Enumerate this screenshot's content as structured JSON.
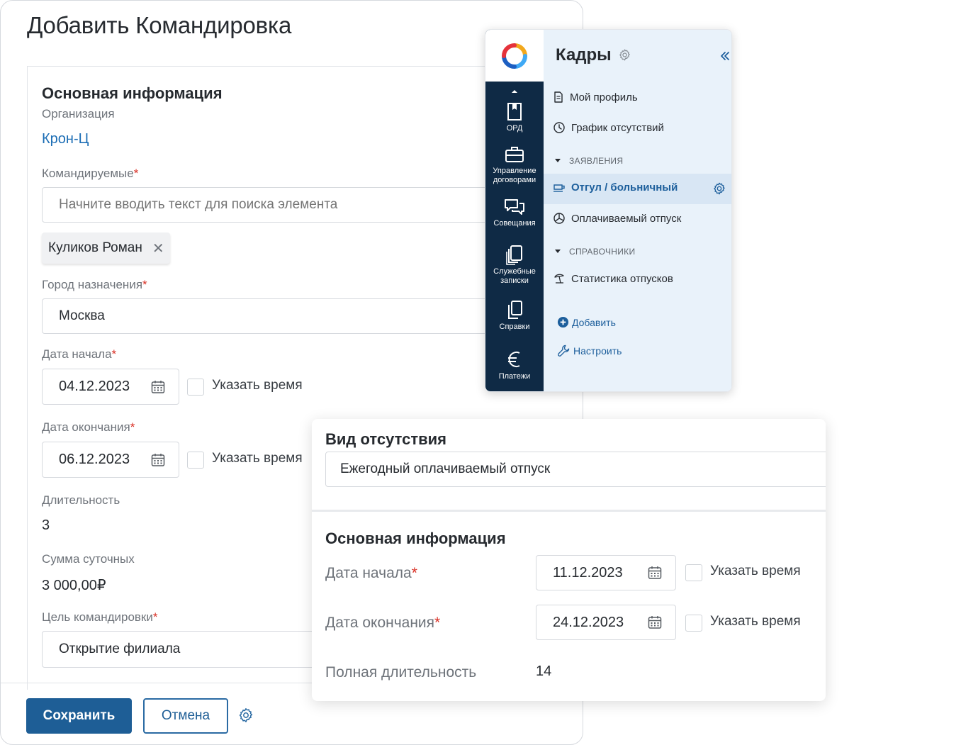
{
  "form": {
    "title": "Добавить Командировка",
    "section_title": "Основная информация",
    "organization_label": "Организация",
    "organization_value": "Крон-Ц",
    "travelers_label": "Командируемые",
    "travelers_placeholder": "Начните вводить текст для поиска элемента",
    "traveler_chip": "Куликов Роман",
    "city_label": "Город назначения",
    "city_value": "Москва",
    "start_label": "Дата начала",
    "start_value": "04.12.2023",
    "end_label": "Дата окончания",
    "end_value": "06.12.2023",
    "specify_time": "Указать время",
    "duration_label": "Длительность",
    "duration_value": "3",
    "per_diem_label": "Сумма суточных",
    "per_diem_value": "3 000,00₽",
    "purpose_label": "Цель командировки",
    "purpose_value": "Открытие филиала",
    "required_mark": "*",
    "save_label": "Сохранить",
    "cancel_label": "Отмена"
  },
  "nav": {
    "app_title": "Кадры",
    "rail": [
      {
        "label": "ОРД",
        "icon": "bookmark-doc-icon"
      },
      {
        "label": "Управление договорами",
        "icon": "briefcase-icon"
      },
      {
        "label": "Совещания",
        "icon": "chat-bubbles-icon"
      },
      {
        "label": "Служебные записки",
        "icon": "stacked-docs-icon"
      },
      {
        "label": "Справки",
        "icon": "copy-docs-icon"
      },
      {
        "label": "Платежи",
        "icon": "euro-icon"
      }
    ],
    "rail_line_1": "Управление",
    "rail_line_2": "договорами",
    "rail_memo_1": "Служебные",
    "rail_memo_2": "записки",
    "items": {
      "profile": "Мой профиль",
      "schedule": "График отсутствий",
      "group_requests": "ЗАЯВЛЕНИЯ",
      "sick": "Отгул / больничный",
      "paid_leave": "Оплачиваемый отпуск",
      "group_refs": "СПРАВОЧНИКИ",
      "stats": "Статистика отпусков",
      "add": "Добавить",
      "configure": "Настроить"
    }
  },
  "absence": {
    "type_label": "Вид отсутствия",
    "type_value": "Ежегодный оплачиваемый отпуск",
    "section_title": "Основная информация",
    "start_label": "Дата начала",
    "start_value": "11.12.2023",
    "end_label": "Дата окончания",
    "end_value": "24.12.2023",
    "specify_time": "Указать время",
    "full_duration_label": "Полная длительность",
    "full_duration_value": "14",
    "required_mark": "*"
  },
  "colors": {
    "primary": "#1e5e96",
    "link": "#1d6eb5",
    "rail": "#0f2a45",
    "panel": "#e9f2fa",
    "required": "#d93025"
  }
}
